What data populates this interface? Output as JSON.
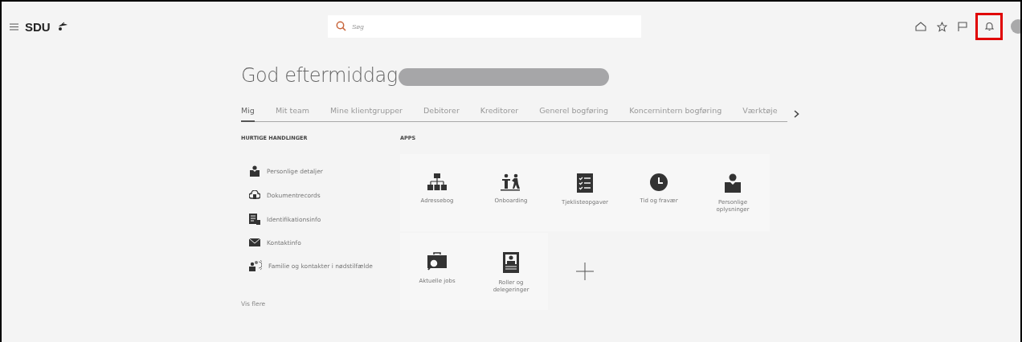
{
  "header": {
    "brand": "SDU",
    "search": {
      "placeholder": "Søg"
    },
    "toolbar": [
      {
        "kind": "home",
        "highlighted": false
      },
      {
        "kind": "favorites",
        "highlighted": false
      },
      {
        "kind": "flag",
        "highlighted": false
      },
      {
        "kind": "notifications",
        "highlighted": true
      }
    ]
  },
  "greeting": {
    "text": "God eftermiddag",
    "name_redacted": true
  },
  "tabs": [
    {
      "label": "Mig",
      "selected": true
    },
    {
      "label": "Mit team",
      "selected": false
    },
    {
      "label": "Mine klientgrupper",
      "selected": false
    },
    {
      "label": "Debitorer",
      "selected": false
    },
    {
      "label": "Kreditorer",
      "selected": false
    },
    {
      "label": "Generel bogføring",
      "selected": false
    },
    {
      "label": "Koncernintern bogføring",
      "selected": false
    },
    {
      "label": "Værktøje",
      "selected": false
    }
  ],
  "quick_actions": {
    "title": "HURTIGE HANDLINGER",
    "items": [
      {
        "label": "Personlige detaljer"
      },
      {
        "label": "Dokumentrecords"
      },
      {
        "label": "Identifikationsinfo"
      },
      {
        "label": "Kontaktinfo"
      },
      {
        "label": "Familie og kontakter i nødstilfælde"
      }
    ],
    "more": "Vis flere"
  },
  "apps": {
    "title": "APPS",
    "tiles": [
      {
        "kind": "app",
        "label": "Adressebog"
      },
      {
        "kind": "app",
        "label": "Onboarding"
      },
      {
        "kind": "app",
        "label": "Tjeklisteopgaver"
      },
      {
        "kind": "app",
        "label": "Tid og fravær"
      },
      {
        "kind": "app",
        "label": "Personlige oplysninger"
      },
      {
        "kind": "app",
        "label": "Aktuelle jobs"
      },
      {
        "kind": "app",
        "label": "Roller og delegeringer"
      },
      {
        "kind": "add"
      }
    ]
  }
}
